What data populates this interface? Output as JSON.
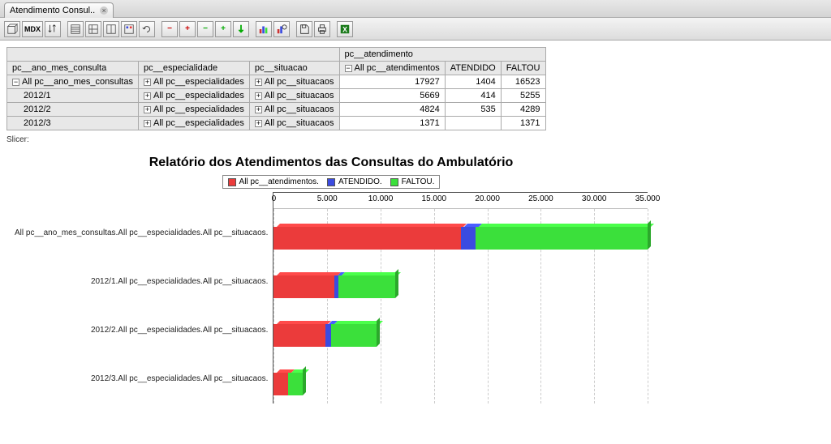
{
  "tab": {
    "title": "Atendimento Consul.."
  },
  "toolbar": {
    "mdx": "MDX"
  },
  "table": {
    "super_header": "pc__atendimento",
    "headers": {
      "ano_mes": "pc__ano_mes_consulta",
      "especialidade": "pc__especialidade",
      "situacao": "pc__situacao",
      "c1": "All pc__atendimentos",
      "c2": "ATENDIDO",
      "c3": "FALTOU"
    },
    "rows": [
      {
        "ano": "All pc__ano_mes_consultas",
        "esp": "All pc__especialidades",
        "sit": "All pc__situacaos",
        "c1": "17927",
        "c2": "1404",
        "c3": "16523",
        "top": true
      },
      {
        "ano": "2012/1",
        "esp": "All pc__especialidades",
        "sit": "All pc__situacaos",
        "c1": "5669",
        "c2": "414",
        "c3": "5255"
      },
      {
        "ano": "2012/2",
        "esp": "All pc__especialidades",
        "sit": "All pc__situacaos",
        "c1": "4824",
        "c2": "535",
        "c3": "4289"
      },
      {
        "ano": "2012/3",
        "esp": "All pc__especialidades",
        "sit": "All pc__situacaos",
        "c1": "1371",
        "c2": "",
        "c3": "1371"
      }
    ]
  },
  "slicer_label": "Slicer:",
  "chart": {
    "title": "Relatório dos Atendimentos das Consultas do Ambulatório",
    "legend": {
      "s1": "All pc__atendimentos.",
      "s2": "ATENDIDO.",
      "s3": "FALTOU."
    },
    "colors": {
      "s1": "#eb3b3b",
      "s2": "#3b4be0",
      "s3": "#3be03b"
    },
    "xticks": [
      "0",
      "5.000",
      "10.000",
      "15.000",
      "20.000",
      "25.000",
      "30.000",
      "35.000"
    ],
    "ylabels": [
      "All pc__ano_mes_consultas.All pc__especialidades.All pc__situacaos.",
      "2012/1.All pc__especialidades.All pc__situacaos.",
      "2012/2.All pc__especialidades.All pc__situacaos.",
      "2012/3.All pc__especialidades.All pc__situacaos."
    ]
  },
  "chart_data": {
    "type": "bar",
    "orientation": "horizontal",
    "stacked": true,
    "title": "Relatório dos Atendimentos das Consultas do Ambulatório",
    "xlabel": "",
    "ylabel": "",
    "xlim": [
      0,
      35000
    ],
    "categories": [
      "All pc__ano_mes_consultas.All pc__especialidades.All pc__situacaos.",
      "2012/1.All pc__especialidades.All pc__situacaos.",
      "2012/2.All pc__especialidades.All pc__situacaos.",
      "2012/3.All pc__especialidades.All pc__situacaos."
    ],
    "series": [
      {
        "name": "All pc__atendimentos.",
        "color": "#eb3b3b",
        "values": [
          17927,
          5669,
          4824,
          1371
        ]
      },
      {
        "name": "ATENDIDO.",
        "color": "#3b4be0",
        "values": [
          1404,
          414,
          535,
          0
        ]
      },
      {
        "name": "FALTOU.",
        "color": "#3be03b",
        "values": [
          16523,
          5255,
          4289,
          1371
        ]
      }
    ]
  }
}
